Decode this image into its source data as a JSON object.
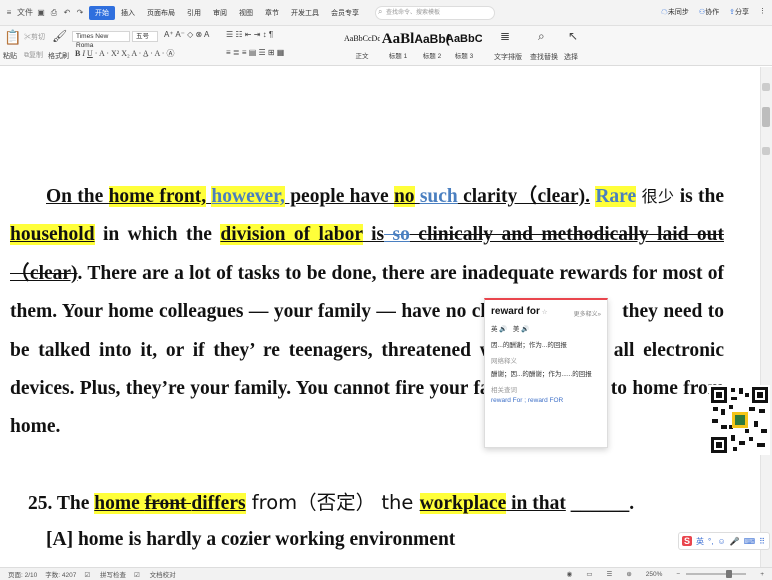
{
  "menubar": {
    "file": "文件",
    "tabs": [
      "开始",
      "插入",
      "页面布局",
      "引用",
      "审阅",
      "视图",
      "章节",
      "开发工具",
      "会员专享"
    ],
    "active_tab": "开始",
    "search_placeholder": "查找命令、搜索模板",
    "right": [
      "未同步",
      "协作",
      "分享"
    ]
  },
  "ribbon": {
    "clipboard": {
      "paste": "粘贴",
      "cut": "剪切",
      "copy": "复制",
      "format_painter": "格式刷"
    },
    "font_name": "Times New Roma",
    "font_size": "五号",
    "styles": [
      {
        "preview": "AaBbCcDd",
        "label": "正文"
      },
      {
        "preview": "AaBl",
        "label": "标题 1"
      },
      {
        "preview": "AaBb(",
        "label": "标题 2"
      },
      {
        "preview": "AaBbC",
        "label": "标题 3"
      }
    ],
    "tools": [
      "文字排版",
      "查找替换",
      "选择"
    ]
  },
  "document": {
    "paragraph": {
      "s01": "On the ",
      "s02": "home front,",
      "s03": " ",
      "s04": "however,",
      "s05": " people have ",
      "s06": "no",
      "s07": " ",
      "s08": "such",
      "s09": " clarity（clear).",
      "s10": " ",
      "s11": "Rare",
      "s12": " 很少",
      "s13": "  is the ",
      "s14": "household",
      "s15": " in which the ",
      "s16": "division of labor",
      "s17": " is",
      "s18": " so",
      "s19": " clinically and methodically laid out（clear)",
      "s20": ". There are a lot of tasks to be done, there are inadequate rewards for most of them. Your home colleagues — your family — have no clear rewards i",
      "s21": " they need to be talked into it, or if they’ re teenagers, threatened with com",
      "s22": " of all electronic devices. Plus, they’re your family. You cannot fire your fam",
      "s23": "really get to home from home."
    },
    "question": {
      "number": "25. The ",
      "w1": "home ",
      "w2": "front ",
      "w3": "differs",
      "w4": " from（否定）  the ",
      "w5": "workplace",
      "w6": " in that",
      "blank": "______",
      "end": "."
    },
    "option_a": "[A] home is hardly a cozier working environment"
  },
  "popup": {
    "title": "reward for",
    "more": "更多释义»",
    "uk": "英",
    "us": "美",
    "def1": "因...的酬谢；作为...的回报",
    "net_label": "网络释义",
    "def2": "酬谢；因...的酬谢；作为......的回报",
    "related_label": "相关查词",
    "related": "reward For ; reward FOR"
  },
  "statusbar": {
    "page": "页面: 2/10",
    "words": "字数: 4207",
    "spell": "拼写检查",
    "doc_check": "文档校对",
    "zoom": "250%"
  },
  "ime": {
    "brand": "S",
    "lang": "英"
  }
}
